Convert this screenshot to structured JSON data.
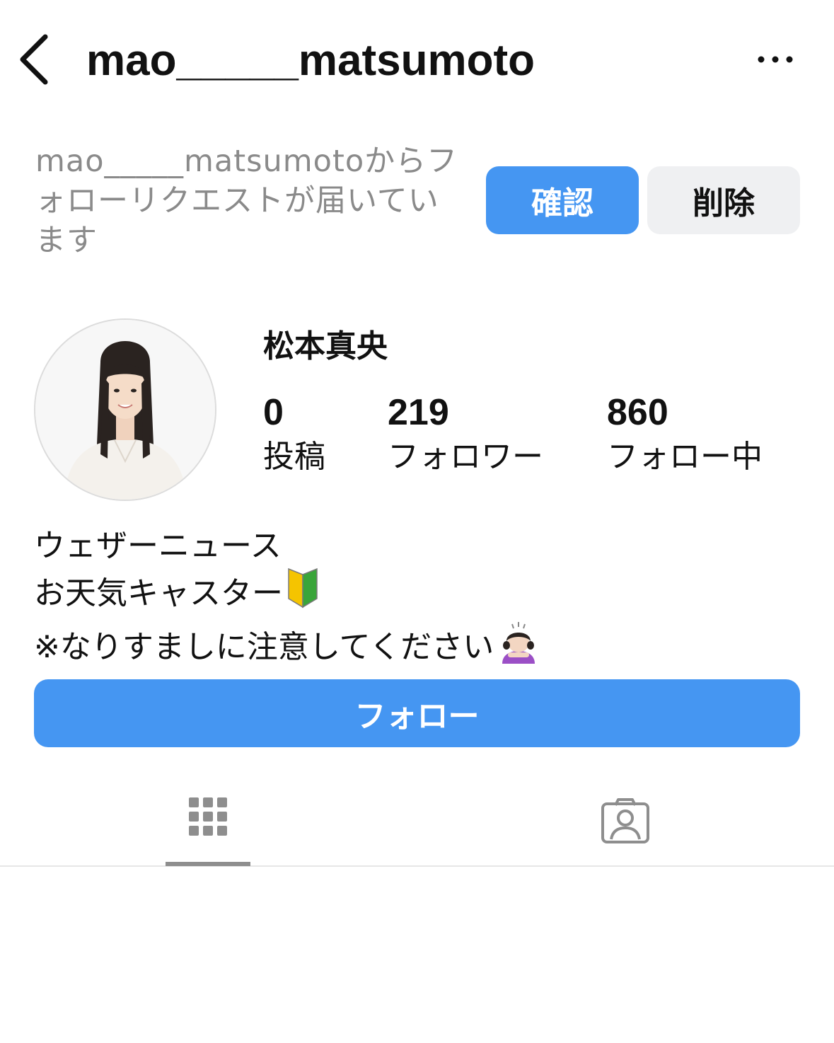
{
  "header": {
    "username": "mao_____matsumoto",
    "back_icon": "chevron-left-icon",
    "more_icon": "more-horizontal-icon"
  },
  "request": {
    "message": "mao_____matsumotoからフォローリクエストが届いています",
    "confirm_label": "確認",
    "delete_label": "削除"
  },
  "profile": {
    "display_name": "松本真央",
    "stats": {
      "posts_count": "0",
      "posts_label": "投稿",
      "followers_count": "219",
      "followers_label": "フォロワー",
      "following_count": "860",
      "following_label": "フォロー中"
    },
    "bio": {
      "line1": "ウェザーニュース",
      "line2": "お天気キャスター",
      "line3": "※なりすましに注意してください"
    }
  },
  "follow_button": {
    "label": "フォロー"
  },
  "tabs": [
    {
      "name": "posts-grid",
      "icon": "grid-icon",
      "active": true
    },
    {
      "name": "tagged",
      "icon": "tagged-person-icon",
      "active": false
    }
  ],
  "colors": {
    "primary_blue": "#4596f2",
    "secondary_button": "#eff0f2",
    "muted_text": "#8a8a8a",
    "icon_gray": "#8e8e8e"
  }
}
